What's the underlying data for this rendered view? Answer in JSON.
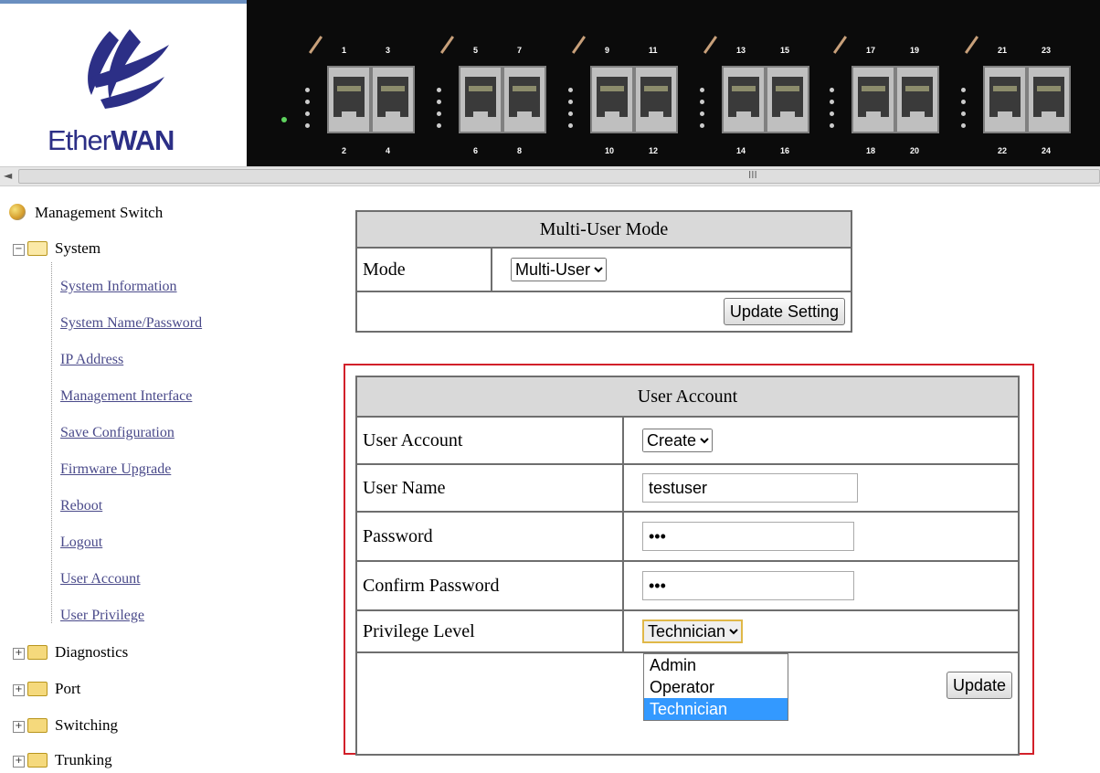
{
  "brand": {
    "logo_text_light": "Ether",
    "logo_text_bold": "WAN"
  },
  "switch_panel": {
    "top_ports": [
      "1",
      "3",
      "5",
      "7",
      "9",
      "11",
      "13",
      "15",
      "17",
      "19",
      "21",
      "23"
    ],
    "bottom_ports": [
      "2",
      "4",
      "6",
      "8",
      "10",
      "12",
      "14",
      "16",
      "18",
      "20",
      "22",
      "24"
    ]
  },
  "scrollbar": {
    "grip": "III"
  },
  "sidebar": {
    "root": "Management Switch",
    "system": {
      "label": "System",
      "items": [
        "System Information",
        "System Name/Password",
        "IP Address",
        "Management Interface",
        "Save Configuration",
        "Firmware Upgrade",
        "Reboot",
        "Logout",
        "User Account",
        "User Privilege"
      ]
    },
    "groups": [
      "Diagnostics",
      "Port",
      "Switching",
      "Trunking"
    ]
  },
  "multi_user": {
    "title": "Multi-User Mode",
    "mode_label": "Mode",
    "mode_value": "Multi-User",
    "update_button": "Update Setting"
  },
  "user_account": {
    "title": "User Account",
    "account_label": "User Account",
    "account_value": "Create",
    "name_label": "User Name",
    "name_value": "testuser",
    "password_label": "Password",
    "password_value": "•••",
    "confirm_label": "Confirm Password",
    "confirm_value": "•••",
    "privilege_label": "Privilege Level",
    "privilege_value": "Technician",
    "privilege_options": [
      "Admin",
      "Operator",
      "Technician"
    ],
    "update_button": "Update"
  },
  "colors": {
    "highlight_frame": "#d2202a",
    "selected_option": "#3399ff"
  }
}
